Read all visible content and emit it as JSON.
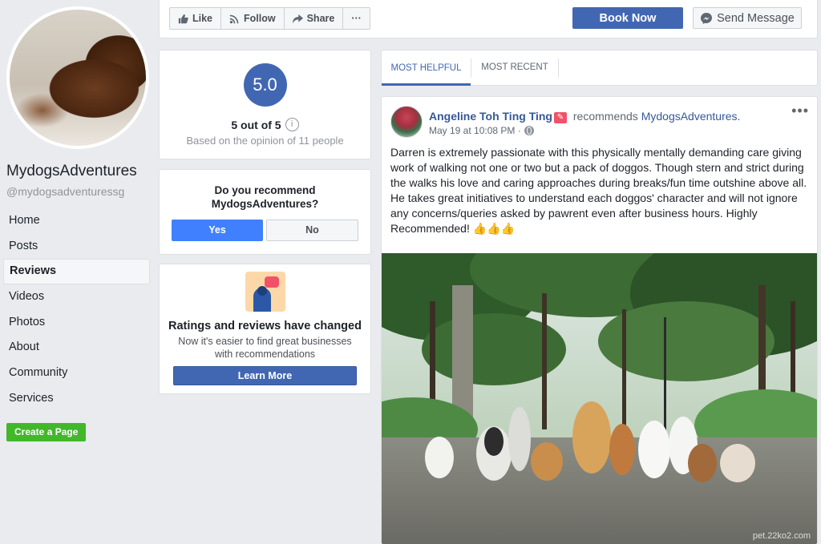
{
  "page": {
    "name": "MydogsAdventures",
    "handle": "@mydogsadventuressg"
  },
  "sidebar": {
    "items": [
      {
        "label": "Home"
      },
      {
        "label": "Posts"
      },
      {
        "label": "Reviews",
        "active": true
      },
      {
        "label": "Videos"
      },
      {
        "label": "Photos"
      },
      {
        "label": "About"
      },
      {
        "label": "Community"
      },
      {
        "label": "Services"
      }
    ],
    "create_page_label": "Create a Page"
  },
  "toolbar": {
    "like_label": "Like",
    "follow_label": "Follow",
    "share_label": "Share",
    "more_label": "···",
    "book_label": "Book Now",
    "message_label": "Send Message"
  },
  "rating": {
    "score": "5.0",
    "out_of": "5 out of 5",
    "info": "i",
    "basis": "Based on the opinion of 11 people"
  },
  "recommend": {
    "question": "Do you recommend MydogsAdventures?",
    "yes_label": "Yes",
    "no_label": "No"
  },
  "changed": {
    "title": "Ratings and reviews have changed",
    "subtitle": "Now it's easier to find great businesses with recommendations",
    "button_label": "Learn More"
  },
  "tabs": [
    {
      "label": "MOST HELPFUL",
      "active": true
    },
    {
      "label": "MOST RECENT",
      "active": false
    }
  ],
  "review": {
    "author": "Angeline Toh Ting Ting",
    "verb": "recommends",
    "page": "MydogsAdventures.",
    "time": "May 19 at 10:08 PM · ",
    "menu": "•••",
    "body": "Darren is extremely passionate with this physically mentally demanding care giving work of walking not one or two but a pack of doggos. Though stern and strict during the walks his love and caring approaches during breaks/fun time outshine above all. He takes great initiatives to understand each doggos' character and will not ignore any concerns/queries asked by pawrent even after business hours. Highly Recommended! 👍👍👍"
  },
  "watermark": "pet.22ko2.com",
  "colors": {
    "brand": "#4267b2",
    "link": "#365899",
    "yes": "#4080ff",
    "create": "#42b72a"
  }
}
